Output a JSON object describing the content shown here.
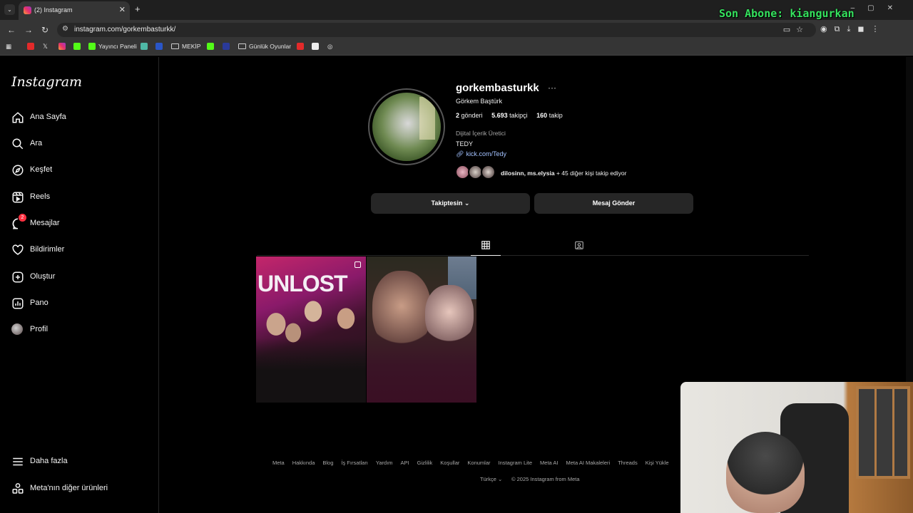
{
  "browser": {
    "tab_title": "(2) Instagram",
    "url": "instagram.com/gorkembasturkk/",
    "overlay_text": "Son Abone: kiangurkan",
    "bookmarks": [
      "Yayıncı Paneli",
      "MEKİP",
      "Günlük Oyunlar"
    ]
  },
  "sidebar": {
    "logo": "Instagram",
    "items": [
      {
        "label": "Ana Sayfa",
        "icon": "home-icon"
      },
      {
        "label": "Ara",
        "icon": "search-icon"
      },
      {
        "label": "Keşfet",
        "icon": "compass-icon"
      },
      {
        "label": "Reels",
        "icon": "reels-icon"
      },
      {
        "label": "Mesajlar",
        "icon": "messenger-icon",
        "badge": "2"
      },
      {
        "label": "Bildirimler",
        "icon": "heart-icon"
      },
      {
        "label": "Oluştur",
        "icon": "plus-square-icon"
      },
      {
        "label": "Pano",
        "icon": "dashboard-icon"
      },
      {
        "label": "Profil",
        "icon": "avatar"
      }
    ],
    "more": "Daha fazla",
    "meta": "Meta'nın diğer ürünleri"
  },
  "profile": {
    "username": "gorkembasturkk",
    "fullname": "Görkem Baştürk",
    "posts_count": "2",
    "posts_label": "gönderi",
    "followers_count": "5.693",
    "followers_label": "takipçi",
    "following_count": "160",
    "following_label": "takip",
    "category": "Dijital İçerik Üretici",
    "bio": "TEDY",
    "link": "kick.com/Tedy",
    "mutual_names": "dilosinn, ms.elysia",
    "mutual_rest": "+ 45 diğer kişi takip ediyor",
    "follow_button": "Takiptesin",
    "message_button": "Mesaj Gönder"
  },
  "posts": [
    {
      "caption_visible": "UNLOST",
      "type": "carousel"
    },
    {
      "type": "photo"
    }
  ],
  "footer": {
    "links": [
      "Meta",
      "Hakkında",
      "Blog",
      "İş Fırsatları",
      "Yardım",
      "API",
      "Gizlilik",
      "Koşullar",
      "Konumlar",
      "Instagram Lite",
      "Meta AI",
      "Meta AI Makaleleri",
      "Threads",
      "Kişi Yükle"
    ],
    "language": "Türkçe",
    "copyright": "© 2025 Instagram from Meta"
  }
}
